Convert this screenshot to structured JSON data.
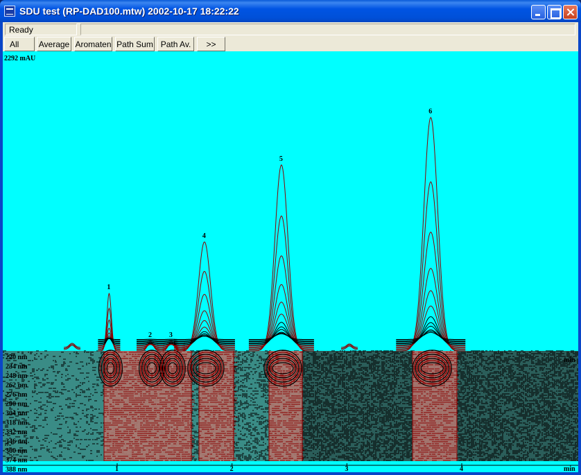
{
  "window": {
    "title": "SDU test (RP-DAD100.mtw) 2002-10-17 18:22:22"
  },
  "status": {
    "text": "Ready",
    "secondary": ""
  },
  "toolbar": {
    "buttons": [
      "All",
      "Average",
      "Aromaten",
      "Path Sum",
      "Path Av.",
      ">>"
    ]
  },
  "colors": {
    "background": "#00FFFF",
    "trace": "#000000",
    "contour": "#8B0000",
    "baseline": "#008080"
  },
  "chart_data": {
    "type": "line",
    "y_max_label": "2292 mAU",
    "x_unit_label": "min",
    "x_ticks": [
      "1",
      "2",
      "3",
      "4"
    ],
    "wavelength_labels": [
      "220 nm",
      "234 nm",
      "248 nm",
      "262 nm",
      "276 nm",
      "290 nm",
      "304 nm",
      "318 nm",
      "332 nm",
      "346 nm",
      "360 nm",
      "374 nm",
      "388 nm"
    ],
    "peaks": [
      {
        "label": "1",
        "time": 0.93,
        "height": 450
      },
      {
        "label": "2",
        "time": 1.29,
        "height": 75
      },
      {
        "label": "3",
        "time": 1.47,
        "height": 75
      },
      {
        "label": "4",
        "time": 1.76,
        "height": 850
      },
      {
        "label": "5",
        "time": 2.43,
        "height": 1450
      },
      {
        "label": "6",
        "time": 3.73,
        "height": 1820
      }
    ],
    "x_range": [
      0,
      4.0
    ],
    "y_range": [
      0,
      2292
    ]
  }
}
